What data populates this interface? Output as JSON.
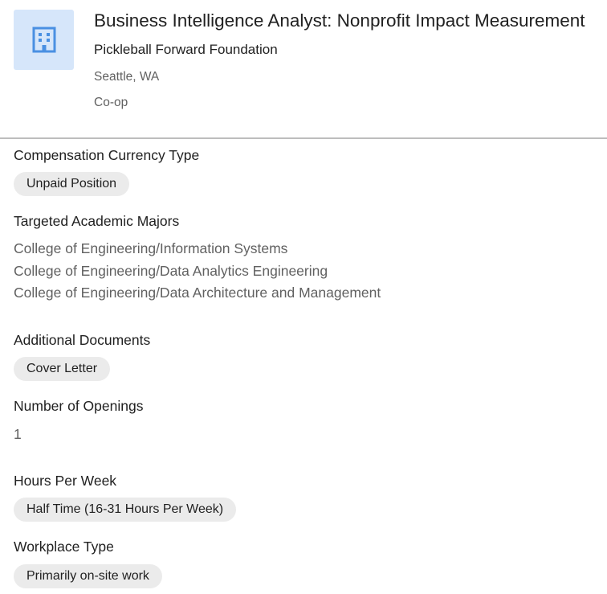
{
  "job": {
    "title": "Business Intelligence Analyst: Nonprofit Impact Measurement",
    "employer": "Pickleball Forward Foundation",
    "location": "Seattle, WA",
    "type": "Co-op",
    "logo_icon": "building-icon"
  },
  "details": {
    "compensation": {
      "label": "Compensation Currency Type",
      "value": "Unpaid Position"
    },
    "majors": {
      "label": "Targeted Academic Majors",
      "items": [
        "College of Engineering/Information Systems",
        "College of Engineering/Data Analytics Engineering",
        "College of Engineering/Data Architecture and Management"
      ]
    },
    "documents": {
      "label": "Additional Documents",
      "value": "Cover Letter"
    },
    "openings": {
      "label": "Number of Openings",
      "value": "1"
    },
    "hours": {
      "label": "Hours Per Week",
      "value": "Half Time (16-31 Hours Per Week)"
    },
    "workplace": {
      "label": "Workplace Type",
      "value": "Primarily on-site work"
    }
  },
  "colors": {
    "logo_background": "#d6e6fa",
    "logo_icon": "#4a90e2",
    "chip_background": "#ebebeb",
    "divider": "#bdbdbd"
  }
}
